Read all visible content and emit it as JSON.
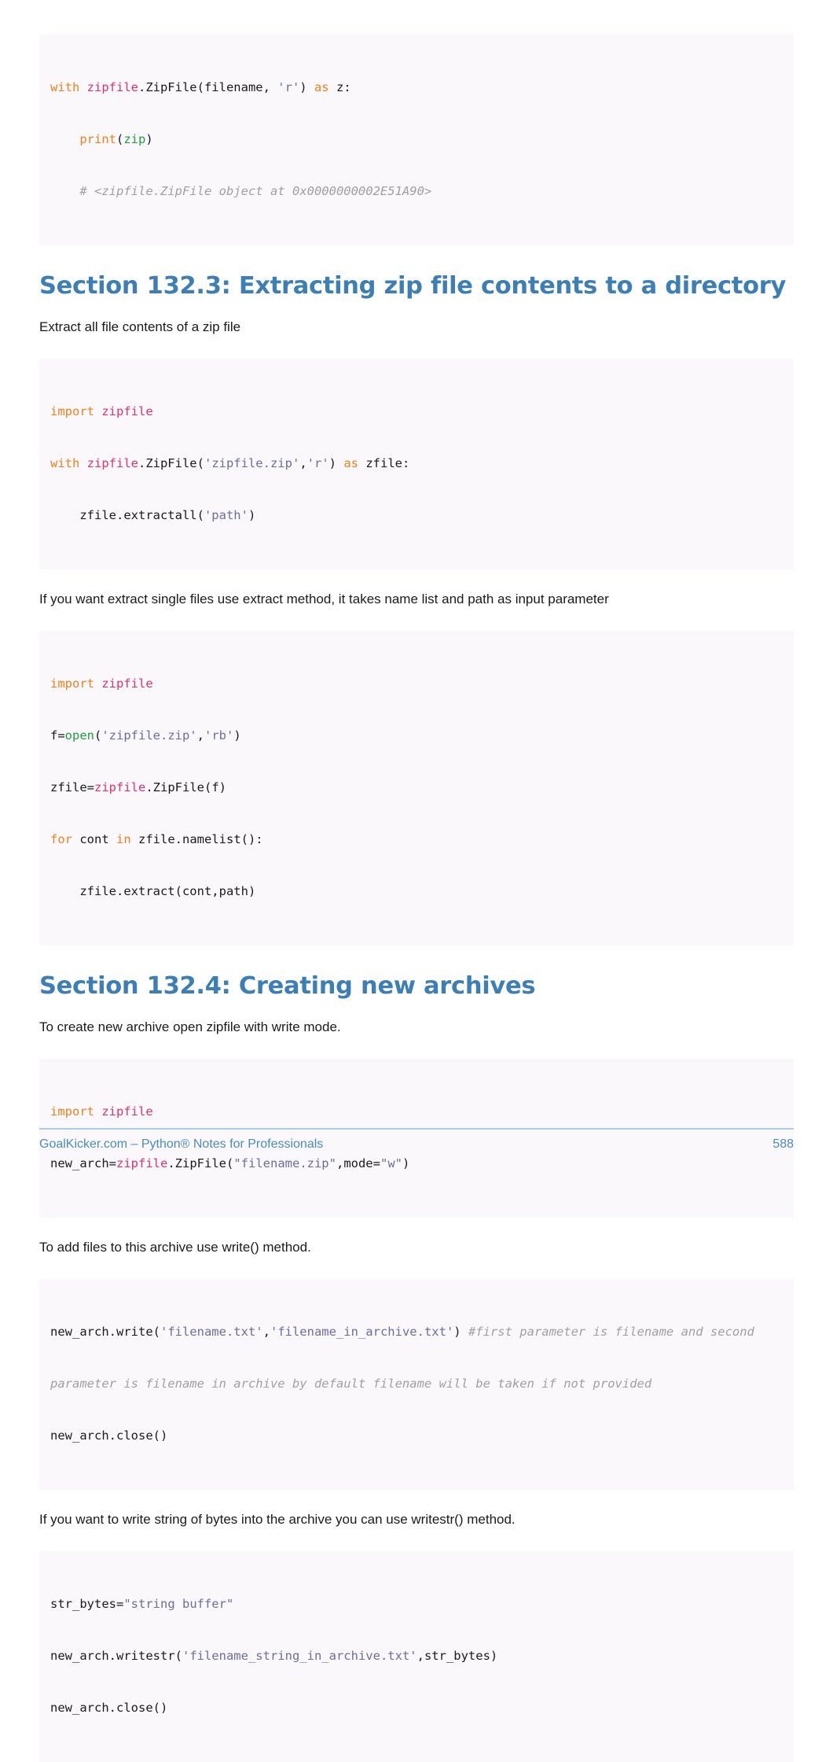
{
  "page": {
    "number": "588",
    "accent_blue": "#3d7fb5",
    "footer_blue": "#4a8cc0",
    "code_bg": "#faf8fb"
  },
  "blocks": {
    "code1": {
      "line1_kw": "with",
      "line1_mod": " zipfile",
      "line1_rest": ".ZipFile(filename, ",
      "line1_str": "'r'",
      "line1_close": ") ",
      "line1_as": "as",
      "line1_tail": " z:",
      "line2_indent": "    ",
      "line2_fn": "print",
      "line2_open": "(",
      "line2_builtin": "zip",
      "line2_close": ")",
      "line3_comment": "    # <zipfile.ZipFile object at 0x0000000002E51A90>"
    },
    "heading1": "Section 132.3: Extracting zip file contents to a directory",
    "para1": "Extract all file contents of a zip file",
    "code2": {
      "line1_kw": "import",
      "line1_mod": " zipfile",
      "line2_kw": "with",
      "line2_mod": " zipfile",
      "line2_dot": ".ZipFile(",
      "line2_str1": "'zipfile.zip'",
      "line2_comma": ",",
      "line2_str2": "'r'",
      "line2_close": ") ",
      "line2_as": "as",
      "line2_tail": " zfile:",
      "line3_indent": "    zfile.extractall(",
      "line3_str": "'path'",
      "line3_close": ")"
    },
    "para2": "If you want extract single files use extract method, it takes name list and path as input parameter",
    "code3": {
      "line1_kw": "import",
      "line1_mod": " zipfile",
      "line2_pre": "f=",
      "line2_builtin": "open",
      "line2_open": "(",
      "line2_str1": "'zipfile.zip'",
      "line2_comma": ",",
      "line2_str2": "'rb'",
      "line2_close": ")",
      "line3_pre": "zfile=",
      "line3_mod": "zipfile",
      "line3_tail": ".ZipFile(f)",
      "line4_kw": "for",
      "line4_mid": " cont ",
      "line4_in": "in",
      "line4_tail": " zfile.namelist():",
      "line5": "    zfile.extract(cont,path)"
    },
    "heading2": "Section 132.4: Creating new archives",
    "para3": "To create new archive open zipfile with write mode.",
    "code4": {
      "line1_kw": "import",
      "line1_mod": " zipfile",
      "line2_pre": "new_arch=",
      "line2_mod": "zipfile",
      "line2_dot": ".ZipFile(",
      "line2_str1": "\"filename.zip\"",
      "line2_mid": ",mode=",
      "line2_str2": "\"w\"",
      "line2_close": ")"
    },
    "para4": "To add files to this archive use write() method.",
    "code5": {
      "line1_pre": "new_arch.write(",
      "line1_str1": "'filename.txt'",
      "line1_comma": ",",
      "line1_str2": "'filename_in_archive.txt'",
      "line1_close": ") ",
      "line1_comment": "#first parameter is filename and second",
      "line2_comment": "parameter is filename in archive by default filename will be taken if not provided",
      "line3": "new_arch.close()"
    },
    "para5": "If you want to write string of bytes into the archive you can use writestr() method.",
    "code6": {
      "line1_pre": "str_bytes=",
      "line1_str": "\"string buffer\"",
      "line2_pre": "new_arch.writestr(",
      "line2_str": "'filename_string_in_archive.txt'",
      "line2_tail": ",str_bytes)",
      "line3": "new_arch.close()"
    }
  },
  "footer": {
    "left": "GoalKicker.com – Python® Notes for Professionals",
    "right": "588"
  }
}
